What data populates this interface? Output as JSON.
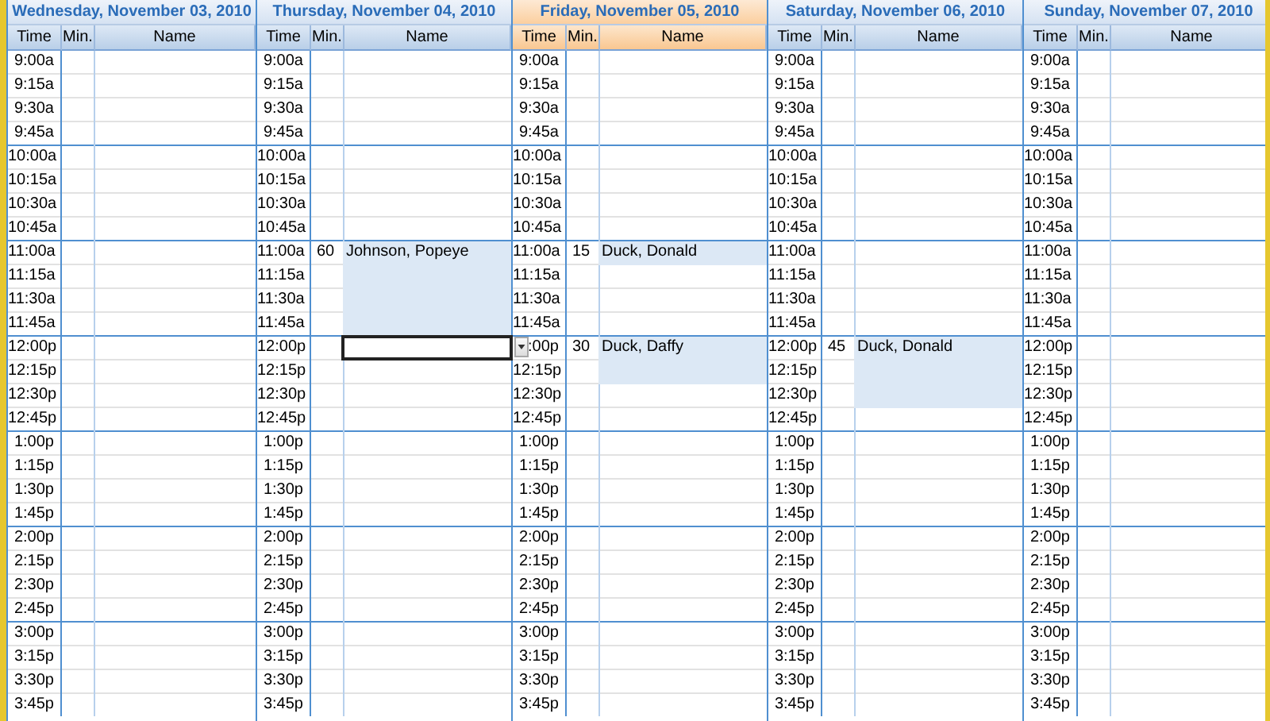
{
  "days": [
    {
      "title": "Wednesday, November 03, 2010",
      "selected": false,
      "columns": [
        "Time",
        "Min.",
        "Name"
      ],
      "rows": [
        {
          "time": "9:00a",
          "selected": false
        },
        {
          "time": "9:15a",
          "selected": false
        },
        {
          "time": "9:30a",
          "selected": false
        },
        {
          "time": "9:45a",
          "selected": false
        },
        {
          "time": "10:00a",
          "selected": false
        },
        {
          "time": "10:15a",
          "selected": false
        },
        {
          "time": "10:30a",
          "selected": false
        },
        {
          "time": "10:45a",
          "selected": false
        },
        {
          "time": "11:00a",
          "selected": false
        },
        {
          "time": "11:15a",
          "selected": false
        },
        {
          "time": "11:30a",
          "selected": false
        },
        {
          "time": "11:45a",
          "selected": false
        },
        {
          "time": "12:00p",
          "selected": false
        },
        {
          "time": "12:15p",
          "selected": false
        },
        {
          "time": "12:30p",
          "selected": false
        },
        {
          "time": "12:45p",
          "selected": false
        },
        {
          "time": "1:00p",
          "selected": false
        },
        {
          "time": "1:15p",
          "selected": false
        },
        {
          "time": "1:30p",
          "selected": false
        },
        {
          "time": "1:45p",
          "selected": false
        },
        {
          "time": "2:00p",
          "selected": false
        },
        {
          "time": "2:15p",
          "selected": false
        },
        {
          "time": "2:30p",
          "selected": false
        },
        {
          "time": "2:45p",
          "selected": false
        },
        {
          "time": "3:00p",
          "selected": false
        },
        {
          "time": "3:15p",
          "selected": false
        },
        {
          "time": "3:30p",
          "selected": false
        },
        {
          "time": "3:45p",
          "selected": false
        }
      ]
    },
    {
      "title": "Thursday, November 04, 2010",
      "selected": false,
      "columns": [
        "Time",
        "Min.",
        "Name"
      ],
      "rows": [
        {
          "time": "9:00a",
          "selected": false
        },
        {
          "time": "9:15a",
          "selected": false
        },
        {
          "time": "9:30a",
          "selected": false
        },
        {
          "time": "9:45a",
          "selected": false
        },
        {
          "time": "10:00a",
          "selected": false
        },
        {
          "time": "10:15a",
          "selected": false
        },
        {
          "time": "10:30a",
          "selected": false
        },
        {
          "time": "10:45a",
          "selected": false
        },
        {
          "time": "11:00a",
          "minutes": "60",
          "name": "Johnson, Popeye",
          "selected": false
        },
        {
          "time": "11:15a",
          "selected": false
        },
        {
          "time": "11:30a",
          "selected": false
        },
        {
          "time": "11:45a",
          "selected": false
        },
        {
          "time": "12:00p",
          "selected": true
        },
        {
          "time": "12:15p",
          "selected": false
        },
        {
          "time": "12:30p",
          "selected": false
        },
        {
          "time": "12:45p",
          "selected": false
        },
        {
          "time": "1:00p",
          "selected": false
        },
        {
          "time": "1:15p",
          "selected": false
        },
        {
          "time": "1:30p",
          "selected": false
        },
        {
          "time": "1:45p",
          "selected": false
        },
        {
          "time": "2:00p",
          "selected": false
        },
        {
          "time": "2:15p",
          "selected": false
        },
        {
          "time": "2:30p",
          "selected": false
        },
        {
          "time": "2:45p",
          "selected": false
        },
        {
          "time": "3:00p",
          "selected": false
        },
        {
          "time": "3:15p",
          "selected": false
        },
        {
          "time": "3:30p",
          "selected": false
        },
        {
          "time": "3:45p",
          "selected": false
        }
      ]
    },
    {
      "title": "Friday, November 05, 2010",
      "selected": true,
      "columns": [
        "Time",
        "Min.",
        "Name"
      ],
      "rows": [
        {
          "time": "9:00a",
          "selected": false
        },
        {
          "time": "9:15a",
          "selected": false
        },
        {
          "time": "9:30a",
          "selected": false
        },
        {
          "time": "9:45a",
          "selected": false
        },
        {
          "time": "10:00a",
          "selected": false
        },
        {
          "time": "10:15a",
          "selected": false
        },
        {
          "time": "10:30a",
          "selected": false
        },
        {
          "time": "10:45a",
          "selected": false
        },
        {
          "time": "11:00a",
          "minutes": "15",
          "name": "Duck, Donald",
          "selected": false
        },
        {
          "time": "11:15a",
          "selected": false
        },
        {
          "time": "11:30a",
          "selected": false
        },
        {
          "time": "11:45a",
          "selected": false
        },
        {
          "time": ":00p",
          "minutes": "30",
          "name": "Duck, Daffy",
          "selected": false
        },
        {
          "time": "12:15p",
          "selected": false
        },
        {
          "time": "12:30p",
          "selected": false
        },
        {
          "time": "12:45p",
          "selected": false
        },
        {
          "time": "1:00p",
          "selected": false
        },
        {
          "time": "1:15p",
          "selected": false
        },
        {
          "time": "1:30p",
          "selected": false
        },
        {
          "time": "1:45p",
          "selected": false
        },
        {
          "time": "2:00p",
          "selected": false
        },
        {
          "time": "2:15p",
          "selected": false
        },
        {
          "time": "2:30p",
          "selected": false
        },
        {
          "time": "2:45p",
          "selected": false
        },
        {
          "time": "3:00p",
          "selected": false
        },
        {
          "time": "3:15p",
          "selected": false
        },
        {
          "time": "3:30p",
          "selected": false
        },
        {
          "time": "3:45p",
          "selected": false
        }
      ]
    },
    {
      "title": "Saturday, November 06, 2010",
      "selected": false,
      "columns": [
        "Time",
        "Min.",
        "Name"
      ],
      "rows": [
        {
          "time": "9:00a",
          "selected": false
        },
        {
          "time": "9:15a",
          "selected": false
        },
        {
          "time": "9:30a",
          "selected": false
        },
        {
          "time": "9:45a",
          "selected": false
        },
        {
          "time": "10:00a",
          "selected": false
        },
        {
          "time": "10:15a",
          "selected": false
        },
        {
          "time": "10:30a",
          "selected": false
        },
        {
          "time": "10:45a",
          "selected": false
        },
        {
          "time": "11:00a",
          "selected": false
        },
        {
          "time": "11:15a",
          "selected": false
        },
        {
          "time": "11:30a",
          "selected": false
        },
        {
          "time": "11:45a",
          "selected": false
        },
        {
          "time": "12:00p",
          "minutes": "45",
          "name": "Duck, Donald",
          "selected": false
        },
        {
          "time": "12:15p",
          "selected": false
        },
        {
          "time": "12:30p",
          "selected": false
        },
        {
          "time": "12:45p",
          "selected": false
        },
        {
          "time": "1:00p",
          "selected": false
        },
        {
          "time": "1:15p",
          "selected": false
        },
        {
          "time": "1:30p",
          "selected": false
        },
        {
          "time": "1:45p",
          "selected": false
        },
        {
          "time": "2:00p",
          "selected": false
        },
        {
          "time": "2:15p",
          "selected": false
        },
        {
          "time": "2:30p",
          "selected": false
        },
        {
          "time": "2:45p",
          "selected": false
        },
        {
          "time": "3:00p",
          "selected": false
        },
        {
          "time": "3:15p",
          "selected": false
        },
        {
          "time": "3:30p",
          "selected": false
        },
        {
          "time": "3:45p",
          "selected": false
        }
      ]
    },
    {
      "title": "Sunday, November 07, 2010",
      "selected": false,
      "columns": [
        "Time",
        "Min.",
        "Name"
      ],
      "rows": [
        {
          "time": "9:00a",
          "selected": false
        },
        {
          "time": "9:15a",
          "selected": false
        },
        {
          "time": "9:30a",
          "selected": false
        },
        {
          "time": "9:45a",
          "selected": false
        },
        {
          "time": "10:00a",
          "selected": false
        },
        {
          "time": "10:15a",
          "selected": false
        },
        {
          "time": "10:30a",
          "selected": false
        },
        {
          "time": "10:45a",
          "selected": false
        },
        {
          "time": "11:00a",
          "selected": false
        },
        {
          "time": "11:15a",
          "selected": false
        },
        {
          "time": "11:30a",
          "selected": false
        },
        {
          "time": "11:45a",
          "selected": false
        },
        {
          "time": "12:00p",
          "selected": false
        },
        {
          "time": "12:15p",
          "selected": false
        },
        {
          "time": "12:30p",
          "selected": false
        },
        {
          "time": "12:45p",
          "selected": false
        },
        {
          "time": "1:00p",
          "selected": false
        },
        {
          "time": "1:15p",
          "selected": false
        },
        {
          "time": "1:30p",
          "selected": false
        },
        {
          "time": "1:45p",
          "selected": false
        },
        {
          "time": "2:00p",
          "selected": false
        },
        {
          "time": "2:15p",
          "selected": false
        },
        {
          "time": "2:30p",
          "selected": false
        },
        {
          "time": "2:45p",
          "selected": false
        },
        {
          "time": "3:00p",
          "selected": false
        },
        {
          "time": "3:15p",
          "selected": false
        },
        {
          "time": "3:30p",
          "selected": false
        },
        {
          "time": "3:45p",
          "selected": false
        }
      ]
    }
  ]
}
